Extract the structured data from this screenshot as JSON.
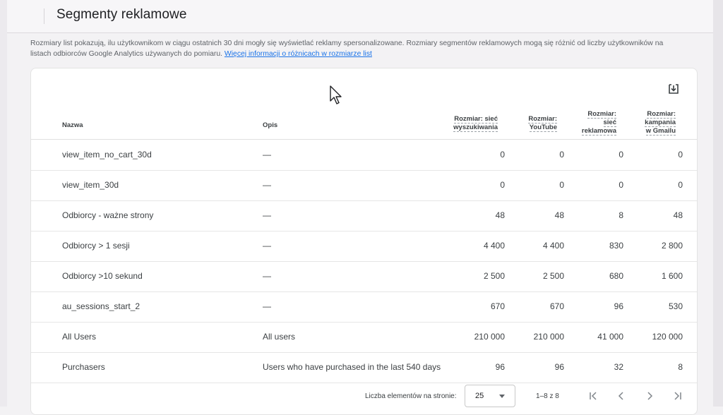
{
  "header": {
    "title": "Segmenty reklamowe"
  },
  "description": {
    "text": "Rozmiary list pokazują, ilu użytkownikom w ciągu ostatnich 30 dni mogły się wyświetlać reklamy spersonalizowane. Rozmiary segmentów reklamowych mogą się różnić od liczby użytkowników na listach odbiorców Google Analytics używanych do pomiaru. ",
    "link": "Więcej informacji o różnicach w rozmiarze list"
  },
  "table": {
    "columns": {
      "name": "Nazwa",
      "desc": "Opis",
      "search_l1": "Rozmiar: sieć",
      "search_l2": "wyszukiwania",
      "youtube_l1": "Rozmiar:",
      "youtube_l2": "YouTube",
      "display_l1": "Rozmiar:",
      "display_l2": "sieć",
      "display_l3": "reklamowa",
      "gmail_l1": "Rozmiar:",
      "gmail_l2": "kampania",
      "gmail_l3": "w Gmailu"
    },
    "rows": [
      {
        "name": "view_item_no_cart_30d",
        "desc": "—",
        "search": "0",
        "youtube": "0",
        "display": "0",
        "gmail": "0"
      },
      {
        "name": "view_item_30d",
        "desc": "—",
        "search": "0",
        "youtube": "0",
        "display": "0",
        "gmail": "0"
      },
      {
        "name": "Odbiorcy - ważne strony",
        "desc": "—",
        "search": "48",
        "youtube": "48",
        "display": "8",
        "gmail": "48"
      },
      {
        "name": "Odbiorcy > 1 sesji",
        "desc": "—",
        "search": "4 400",
        "youtube": "4 400",
        "display": "830",
        "gmail": "2 800"
      },
      {
        "name": "Odbiorcy >10 sekund",
        "desc": "—",
        "search": "2 500",
        "youtube": "2 500",
        "display": "680",
        "gmail": "1 600"
      },
      {
        "name": "au_sessions_start_2",
        "desc": "—",
        "search": "670",
        "youtube": "670",
        "display": "96",
        "gmail": "530"
      },
      {
        "name": "All Users",
        "desc": "All users",
        "search": "210 000",
        "youtube": "210 000",
        "display": "41 000",
        "gmail": "120 000"
      },
      {
        "name": "Purchasers",
        "desc": "Users who have purchased in the last 540 days",
        "search": "96",
        "youtube": "96",
        "display": "32",
        "gmail": "8"
      }
    ]
  },
  "pagination": {
    "per_page_label": "Liczba elementów na stronie:",
    "per_page_value": "25",
    "range": "1–8 z 8"
  },
  "icons": {
    "download": "download-icon",
    "cursor": "mouse-cursor-icon",
    "first": "first-page-icon",
    "prev": "chevron-left-icon",
    "next": "chevron-right-icon",
    "last": "last-page-icon"
  }
}
